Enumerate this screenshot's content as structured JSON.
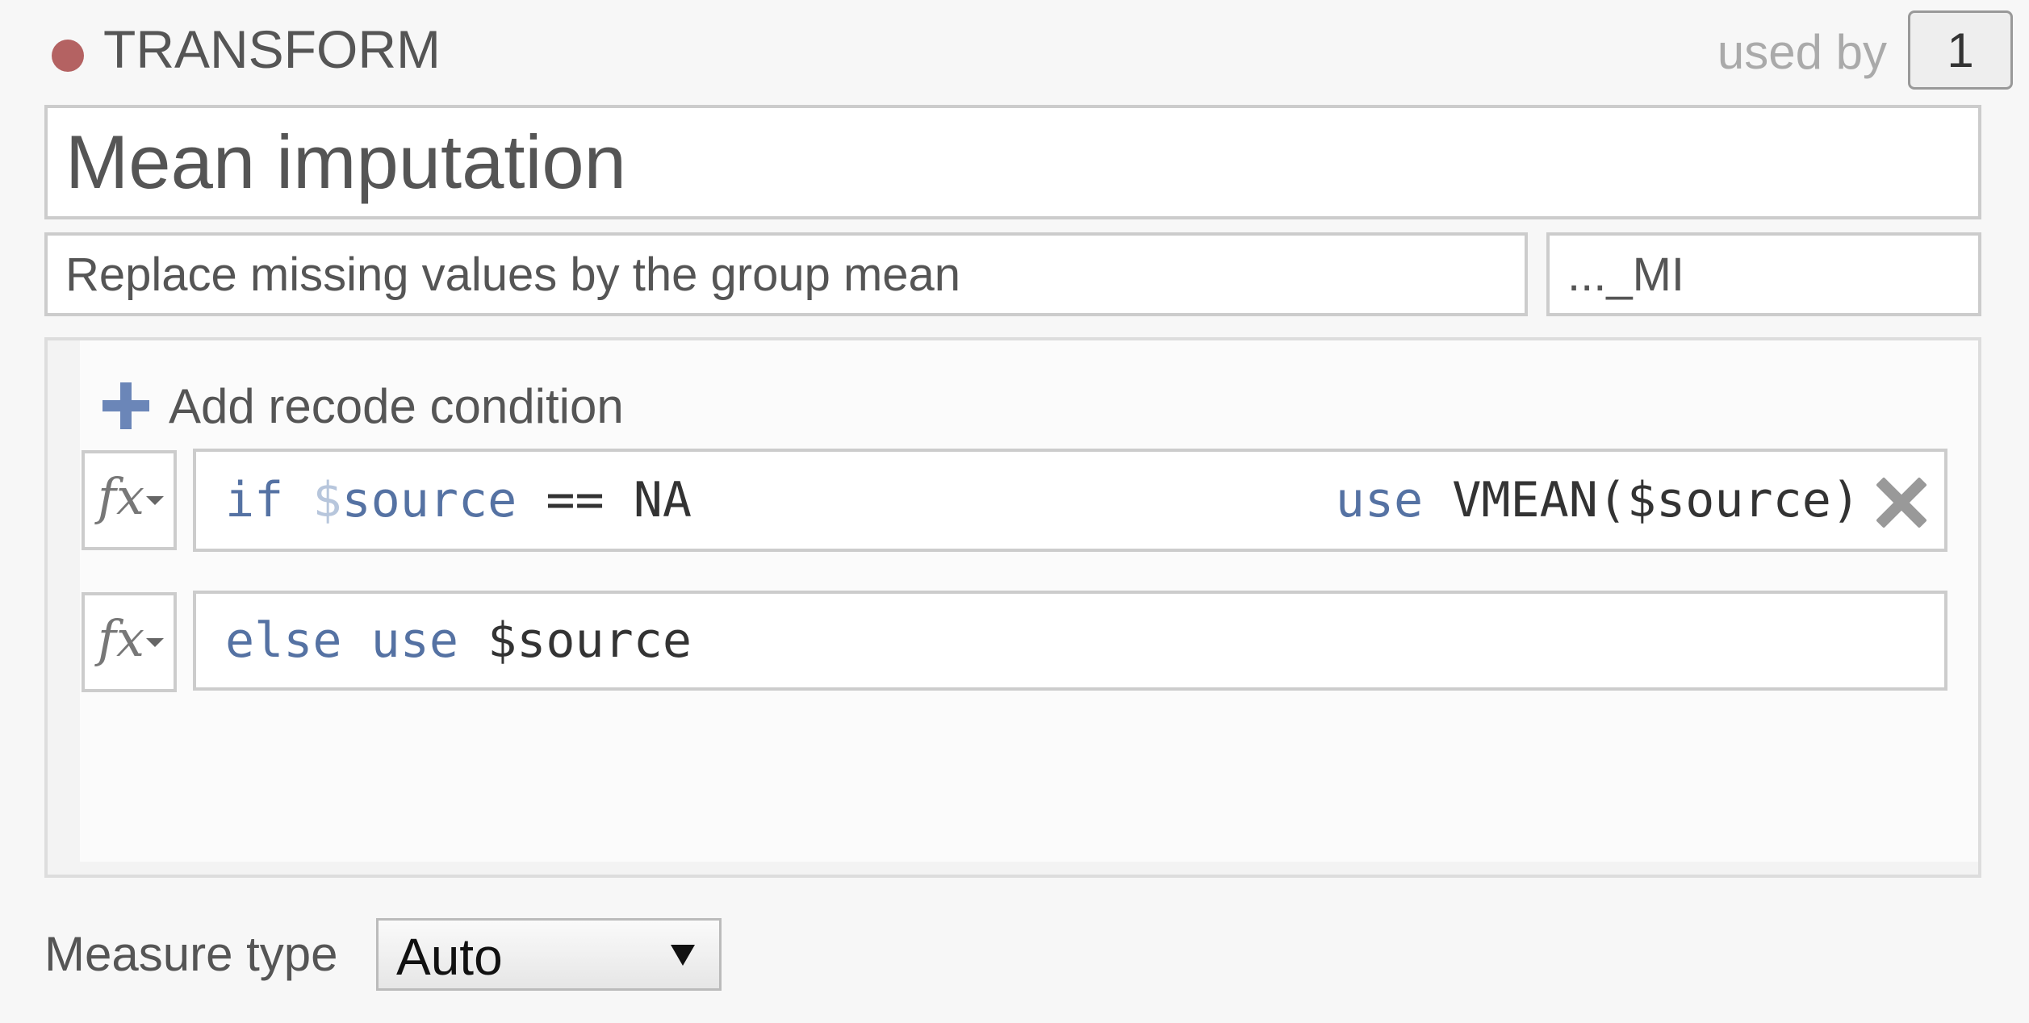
{
  "header": {
    "section_label": "TRANSFORM",
    "status_color": "#b46262",
    "used_by_label": "used by",
    "used_by_count": "1"
  },
  "transform": {
    "title": "Mean imputation",
    "description": "Replace missing values by the group mean",
    "suffix": "..._MI"
  },
  "recode": {
    "add_condition_label": "Add recode condition",
    "rules": [
      {
        "keyword_if": "if",
        "dollar": "$",
        "variable": "source",
        "operator_value": "== NA",
        "keyword_use": "use",
        "expression": "VMEAN($source)"
      },
      {
        "keyword_else": "else",
        "keyword_use": "use",
        "expression": "$source"
      }
    ]
  },
  "measure": {
    "label": "Measure type",
    "selected": "Auto"
  },
  "icons": {
    "status": "status-dot-icon",
    "add": "plus-icon",
    "function": "fx-icon",
    "dropdown": "caret-down-icon",
    "remove": "close-icon"
  },
  "colors": {
    "accent": "#6b86b8",
    "keyword": "#5572a3"
  }
}
